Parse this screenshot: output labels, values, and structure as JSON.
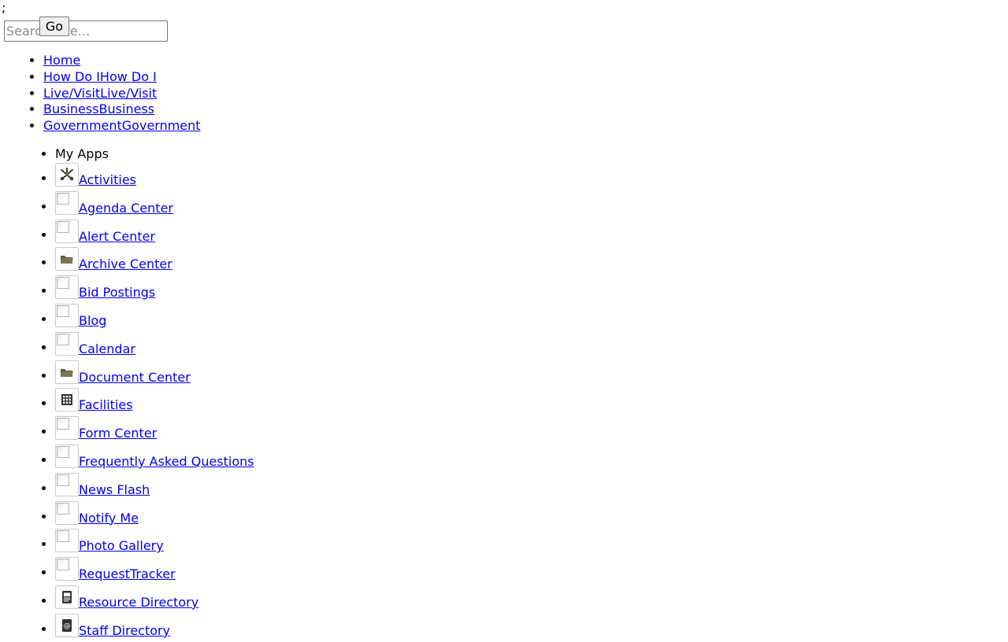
{
  "stray_text": ";",
  "search": {
    "placeholder": "Search Site...",
    "go_label": "Go"
  },
  "main_nav": {
    "items": [
      {
        "label": "Home"
      },
      {
        "label": "How Do IHow Do I"
      },
      {
        "label": "Live/VisitLive/Visit"
      },
      {
        "label": "BusinessBusiness"
      },
      {
        "label": "GovernmentGovernment"
      }
    ]
  },
  "apps": {
    "heading": "My Apps",
    "items": [
      {
        "label": "Activities",
        "icon": "activities-icon"
      },
      {
        "label": "Agenda Center",
        "icon": "broken-image-icon"
      },
      {
        "label": "Alert Center",
        "icon": "broken-image-icon"
      },
      {
        "label": "Archive Center",
        "icon": "folder-icon"
      },
      {
        "label": "Bid Postings",
        "icon": "broken-image-icon"
      },
      {
        "label": "Blog",
        "icon": "broken-image-icon"
      },
      {
        "label": "Calendar",
        "icon": "broken-image-icon"
      },
      {
        "label": "Document Center",
        "icon": "folder-icon"
      },
      {
        "label": "Facilities",
        "icon": "building-icon"
      },
      {
        "label": "Form Center",
        "icon": "broken-image-icon"
      },
      {
        "label": "Frequently Asked Questions",
        "icon": "broken-image-icon"
      },
      {
        "label": "News Flash",
        "icon": "broken-image-icon"
      },
      {
        "label": "Notify Me",
        "icon": "broken-image-icon"
      },
      {
        "label": "Photo Gallery",
        "icon": "broken-image-icon"
      },
      {
        "label": "RequestTracker",
        "icon": "broken-image-icon"
      },
      {
        "label": "Resource Directory",
        "icon": "address-book-icon"
      },
      {
        "label": "Staff Directory",
        "icon": "contact-card-icon"
      }
    ]
  }
}
